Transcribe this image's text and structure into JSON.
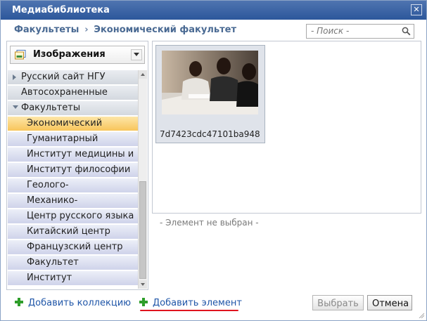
{
  "dialog": {
    "title": "Медиабиблиотека"
  },
  "breadcrumb": {
    "items": [
      "Факультеты",
      "Экономический факультет"
    ],
    "separator": "›"
  },
  "search": {
    "placeholder": "- Поиск -"
  },
  "library_dropdown": {
    "selected": "Изображения"
  },
  "tree": {
    "items": [
      {
        "label": "Русский сайт НГУ",
        "level": 0,
        "expandable": true,
        "expanded": false
      },
      {
        "label": "Автосохраненные",
        "level": 0,
        "expandable": false
      },
      {
        "label": "Факультеты",
        "level": 0,
        "expandable": true,
        "expanded": true
      },
      {
        "label": "Экономический",
        "level": 1,
        "selected": true
      },
      {
        "label": "Гуманитарный",
        "level": 1
      },
      {
        "label": "Институт медицины и",
        "level": 1
      },
      {
        "label": "Институт философии",
        "level": 1
      },
      {
        "label": "Геолого-",
        "level": 1
      },
      {
        "label": "Механико-",
        "level": 1
      },
      {
        "label": "Центр русского языка",
        "level": 1
      },
      {
        "label": "Китайский центр",
        "level": 1
      },
      {
        "label": "Французский центр",
        "level": 1
      },
      {
        "label": "Факультет",
        "level": 1
      },
      {
        "label": "Институт",
        "level": 1
      }
    ]
  },
  "media": {
    "items": [
      {
        "caption": "7d7423cdc47101ba948"
      }
    ]
  },
  "selection_status": "- Элемент не выбран -",
  "footer": {
    "add_collection": "Добавить коллекцию",
    "add_element": "Добавить элемент",
    "select_button": "Выбрать",
    "cancel_button": "Отмена"
  },
  "colors": {
    "title_bar": "#2c579b",
    "link": "#1f56a8",
    "selected_item": "#f8c55b",
    "annotation_underline": "#e0141e",
    "plus_icon": "#2e9e2a"
  },
  "icons": {
    "close": "close-icon",
    "search": "search-icon",
    "library": "images-library-icon",
    "dropdown": "chevron-down-icon",
    "add": "plus-icon"
  }
}
